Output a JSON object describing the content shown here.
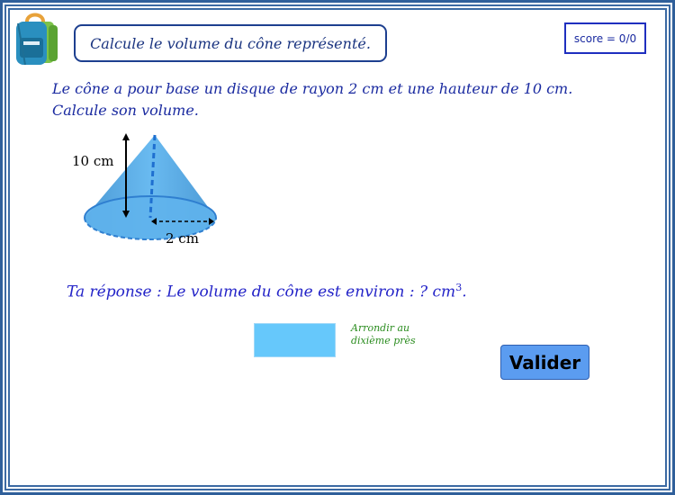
{
  "header": {
    "title": "Calcule le volume du cône représenté.",
    "score": "score = 0/0"
  },
  "statement": {
    "line1": "Le cône a pour base un disque de rayon 2 cm et une hauteur de 10 cm.",
    "line2": "Calcule son volume."
  },
  "figure": {
    "height_label": "10 cm",
    "radius_label": "2 cm",
    "cone_fill": "#5aaee8"
  },
  "answer": {
    "prefix": "Ta réponse :",
    "text": "Le volume du cône est environ : ? cm",
    "exponent": "3",
    "suffix": ".",
    "input_value": "",
    "hint_line1": "Arrondir au",
    "hint_line2": "dixième près"
  },
  "buttons": {
    "validate": "Valider"
  }
}
